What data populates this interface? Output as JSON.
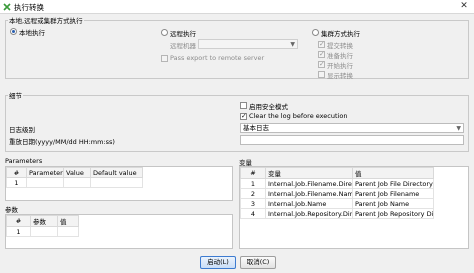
{
  "window": {
    "title": "执行转换",
    "close_glyph": "✕"
  },
  "mode": {
    "group_title": "本地,远程或集群方式执行",
    "local_label": "本地执行",
    "remote_label": "远程执行",
    "remote_server_label": "远程机器",
    "pass_export_label": "Pass export to remote server",
    "cluster_label": "集群方式执行",
    "cluster_options": [
      "提交转换",
      "准备执行",
      "开始执行",
      "显示转换"
    ]
  },
  "details": {
    "group_title": "细节",
    "safe_mode_label": "启用安全模式",
    "clear_log_label": "Clear the log before execution",
    "log_level_label": "日志级别",
    "log_level_value": "基本日志",
    "replay_date_label": "重放日期(yyyy/MM/dd HH:mm:ss)",
    "replay_date_value": ""
  },
  "parameters": {
    "title": "Parameters",
    "columns": [
      "#",
      "Parameter",
      "Value",
      "Default value"
    ],
    "rows": [
      [
        "1",
        "",
        "",
        ""
      ]
    ]
  },
  "arguments": {
    "title": "参数",
    "columns": [
      "#",
      "参数",
      "值"
    ],
    "rows": [
      [
        "1",
        "",
        ""
      ]
    ]
  },
  "variables": {
    "title": "变量",
    "columns": [
      "#",
      "变量",
      "值"
    ],
    "rows": [
      [
        "1",
        "Internal.Job.Filename.Direc...",
        "Parent Job File Directory"
      ],
      [
        "2",
        "Internal.Job.Filename.Name",
        "Parent Job Filename"
      ],
      [
        "3",
        "Internal.Job.Name",
        "Parent Job Name"
      ],
      [
        "4",
        "Internal.Job.Repository.Dir...",
        "Parent Job Repository Dir..."
      ]
    ]
  },
  "buttons": {
    "launch": "启动(L)",
    "cancel": "取消(C)"
  },
  "colors": {
    "default_button": "#c9def7",
    "radio_dot": "#2a5fb0"
  }
}
